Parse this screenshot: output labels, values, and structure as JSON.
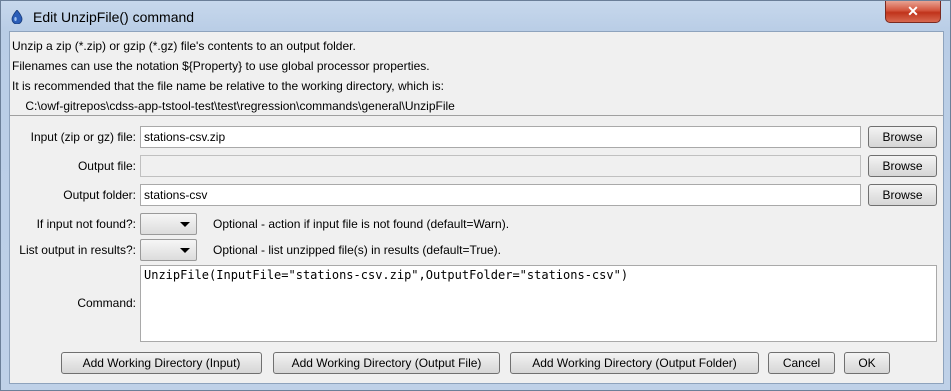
{
  "window": {
    "title": "Edit UnzipFile() command",
    "close_label": "✕"
  },
  "info_lines": [
    "Unzip a zip (*.zip) or gzip (*.gz) file's contents to an output folder.",
    "Filenames can use the notation ${Property} to use global processor properties.",
    "It is recommended that the file name be relative to the working directory, which is:",
    "    C:\\owf-gitrepos\\cdss-app-tstool-test\\test\\regression\\commands\\general\\UnzipFile"
  ],
  "form": {
    "input_file": {
      "label": "Input (zip or gz) file:",
      "value": "stations-csv.zip",
      "browse": "Browse"
    },
    "output_file": {
      "label": "Output file:",
      "value": "",
      "browse": "Browse"
    },
    "output_folder": {
      "label": "Output folder:",
      "value": "stations-csv",
      "browse": "Browse"
    },
    "if_input_not_found": {
      "label": "If input not found?:",
      "value": "",
      "note": "Optional - action if input file is not found (default=Warn)."
    },
    "list_output": {
      "label": "List output in results?:",
      "value": "",
      "note": "Optional - list unzipped file(s) in results (default=True)."
    },
    "command": {
      "label": "Command:",
      "value": "UnzipFile(InputFile=\"stations-csv.zip\",OutputFolder=\"stations-csv\")"
    }
  },
  "buttons": {
    "add_wd_input": "Add Working Directory (Input)",
    "add_wd_output_file": "Add Working Directory (Output File)",
    "add_wd_output_folder": "Add Working Directory (Output Folder)",
    "cancel": "Cancel",
    "ok": "OK"
  },
  "colors": {
    "title_bar": "#bfd1e8",
    "close_button": "#c0331b",
    "client_bg": "#f0f0f0"
  }
}
